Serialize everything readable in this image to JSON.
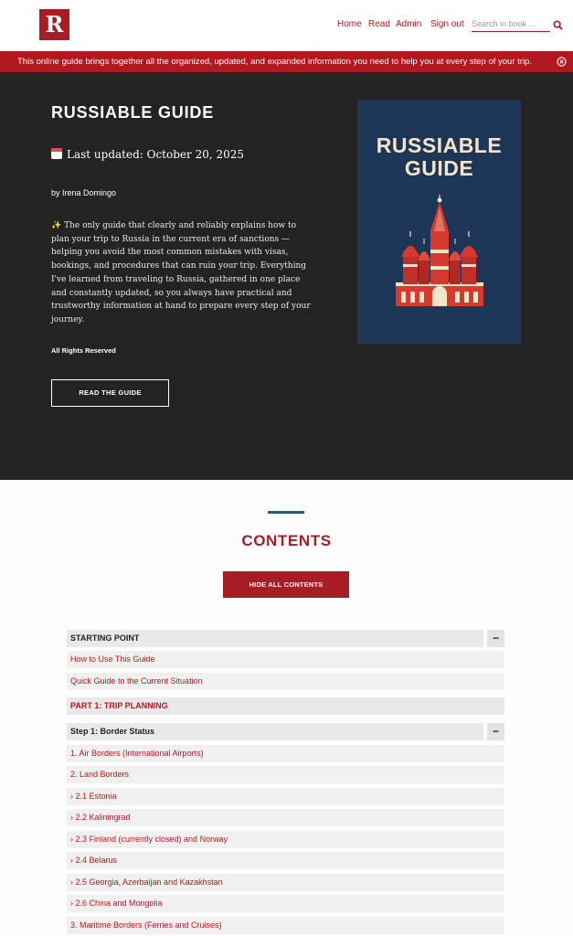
{
  "header": {
    "logo_letter": "R",
    "nav": [
      "Home",
      "Read",
      "Admin",
      "Sign out"
    ],
    "search_placeholder": "Search in book ..."
  },
  "banner": {
    "text": "This online guide brings together all the organized, updated, and expanded information you need to help you at every step of your trip."
  },
  "hero": {
    "title": "RUSSIABLE GUIDE",
    "updated": "Last updated: October 20, 2025",
    "author": "by Irena Domingo",
    "description": "The only guide that clearly and reliably explains how to plan your trip to Russia in the current era of sanctions — helping you avoid the most common mistakes with visas, bookings, and procedures that can ruin your trip. Everything I've learned from traveling to Russia, gathered in one place and constantly updated, so you always have practical and trustworthy information at hand to prepare every step of your journey.",
    "rights": "All Rights Reserved",
    "read_button": "READ THE GUIDE",
    "cover_title_line1": "RUSSIABLE",
    "cover_title_line2": "GUIDE"
  },
  "contents": {
    "title": "CONTENTS",
    "hide_button": "HIDE ALL CONTENTS",
    "rows": [
      {
        "label": "STARTING POINT",
        "kind": "section"
      },
      {
        "label": "How to Use This Guide",
        "kind": "link"
      },
      {
        "label": "Quick Guide to the Current Situation",
        "kind": "link"
      },
      {
        "label": "PART 1: TRIP PLANNING",
        "kind": "part"
      },
      {
        "label": "Step 1: Border Status",
        "kind": "section"
      },
      {
        "label": "1. Air Borders (International Airports)",
        "kind": "link"
      },
      {
        "label": "2. Land Borders",
        "kind": "link"
      },
      {
        "label": "› 2.1 Estonia",
        "kind": "link"
      },
      {
        "label": "› 2.2 Kaliningrad",
        "kind": "link"
      },
      {
        "label": "› 2.3 Finland (currently closed) and Norway",
        "kind": "link"
      },
      {
        "label": "› 2.4 Belarus",
        "kind": "link"
      },
      {
        "label": "› 2.5 Georgia, Azerbaijan and Kazakhstan",
        "kind": "link"
      },
      {
        "label": "› 2.6 China and Mongolia",
        "kind": "link"
      },
      {
        "label": "3. Maritime Borders (Ferries and Cruises)",
        "kind": "link"
      }
    ],
    "toggle_symbol": "−"
  },
  "colors": {
    "brand": "#a81d24",
    "hero_bg": "#232323",
    "cover_bg": "#1d3557"
  }
}
